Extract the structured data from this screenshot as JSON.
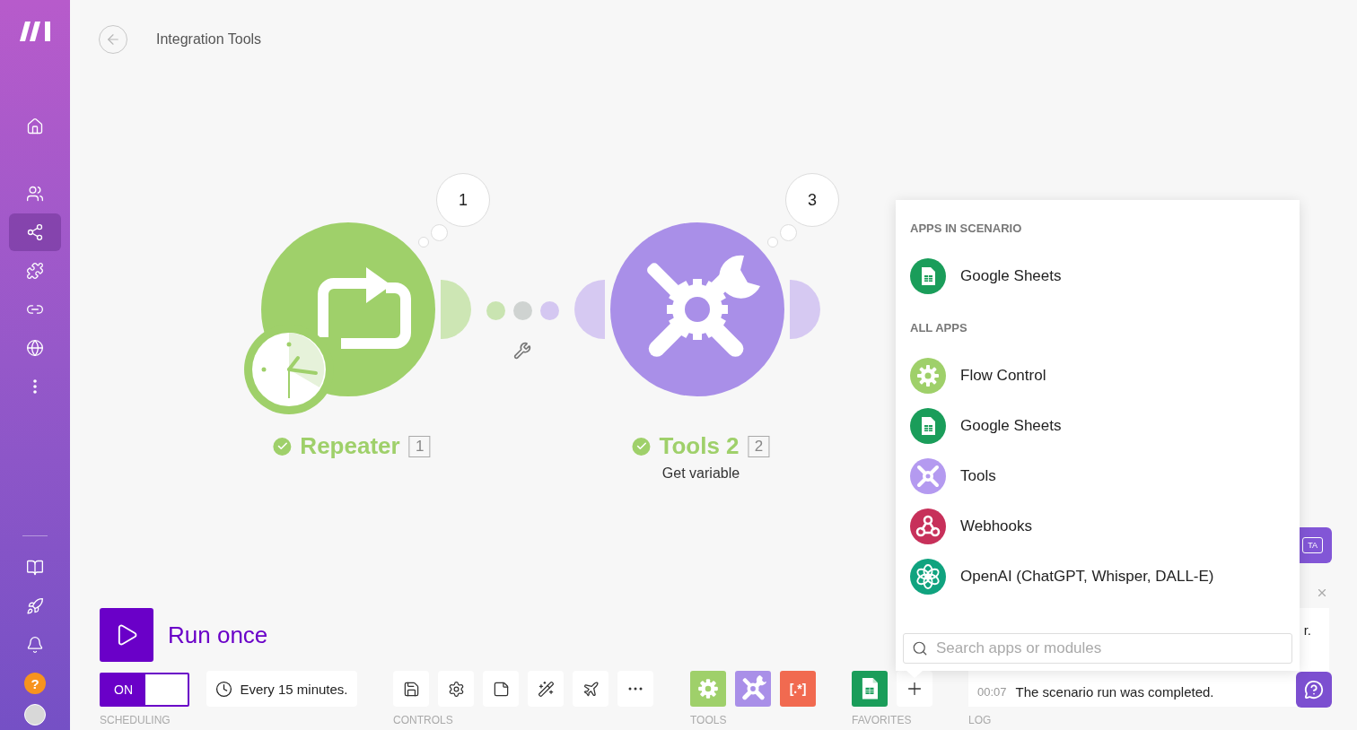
{
  "sidebar": {
    "items": [
      {
        "kind": "home",
        "selected": false
      },
      {
        "kind": "team",
        "selected": false
      },
      {
        "kind": "scenarios",
        "selected": true
      },
      {
        "kind": "apps",
        "selected": false
      },
      {
        "kind": "connections",
        "selected": false
      },
      {
        "kind": "webhooks",
        "selected": false
      },
      {
        "kind": "more",
        "selected": false
      }
    ],
    "bottom_items": [
      {
        "kind": "docs"
      },
      {
        "kind": "launch"
      },
      {
        "kind": "notifications"
      }
    ],
    "help_badge": "?"
  },
  "header": {
    "title": "Integration Tools"
  },
  "scenario": {
    "modules": [
      {
        "kind": "repeater",
        "name": "Repeater",
        "number": "1",
        "bubble": "1",
        "done": true
      },
      {
        "kind": "tools",
        "name": "Tools 2",
        "number": "2",
        "bubble": "3",
        "done": true,
        "subtitle": "Get variable"
      }
    ]
  },
  "run_button": {
    "label": "Run once"
  },
  "scheduling": {
    "label": "SCHEDULING",
    "toggle": {
      "text": "ON",
      "on": true
    },
    "schedule": "Every 15 minutes."
  },
  "controls": {
    "label": "CONTROLS",
    "buttons": [
      {
        "kind": "save"
      },
      {
        "kind": "settings"
      },
      {
        "kind": "notes"
      },
      {
        "kind": "magic"
      },
      {
        "kind": "flight"
      },
      {
        "kind": "more"
      }
    ]
  },
  "tools": {
    "label": "TOOLS",
    "buttons": [
      {
        "kind": "flow"
      },
      {
        "kind": "tools"
      },
      {
        "kind": "text",
        "glyph": "[.*]"
      }
    ]
  },
  "favorites": {
    "label": "FAVORITES",
    "buttons": [
      {
        "kind": "sheets"
      }
    ]
  },
  "log": {
    "label": "LOG",
    "partial": "r.",
    "entries": [
      {
        "time": "00:07",
        "text": "The scenario run was completed."
      }
    ]
  },
  "hidden_button": {
    "label": "TA"
  },
  "app_picker": {
    "sections": [
      {
        "title": "APPS IN SCENARIO",
        "apps": [
          {
            "kind": "sheets",
            "name": "Google Sheets"
          }
        ]
      },
      {
        "title": "ALL APPS",
        "apps": [
          {
            "kind": "flow",
            "name": "Flow Control"
          },
          {
            "kind": "sheets",
            "name": "Google Sheets"
          },
          {
            "kind": "tools",
            "name": "Tools"
          },
          {
            "kind": "webhooks",
            "name": "Webhooks"
          },
          {
            "kind": "openai",
            "name": "OpenAI (ChatGPT, Whisper, DALL-E)"
          }
        ]
      }
    ],
    "search": {
      "placeholder": "Search apps or modules"
    }
  }
}
